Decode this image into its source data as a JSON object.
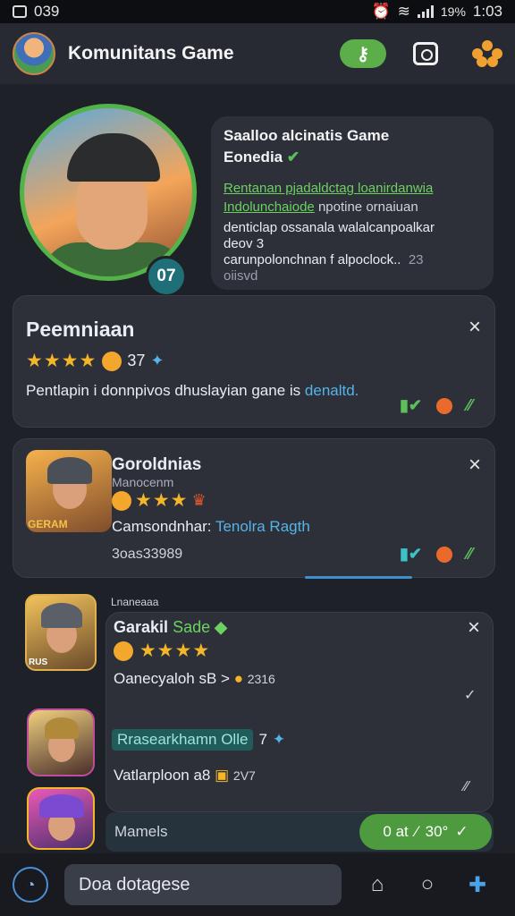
{
  "status_bar": {
    "time_left": "039",
    "battery": "19%",
    "time_right": "1:03"
  },
  "header": {
    "title": "Komunitans Game",
    "pill_icon": "key-icon"
  },
  "profile": {
    "level": "07",
    "info_title_1": "Saalloo alcinatis Game",
    "info_title_2": "Eonedia",
    "info_green_1": "Rentanan pjadaldctag loanirdanwia",
    "info_green_2": "Indolunchaiode",
    "info_green_2_rest": "npotine ornaiuan",
    "info_line_1": "denticlap ossanala walalcanpoalkar",
    "info_line_2": "deov 3",
    "info_line_3": "carunpolonchnan f alpoclock..",
    "info_line_3_num": "23",
    "info_line_4": "oiisvd"
  },
  "card1": {
    "title": "Peemniaan",
    "rating_count": "37",
    "desc": "Pentlapin i donnpivos dhuslayian gane is",
    "desc_link": "denaltd."
  },
  "card2": {
    "title": "Goroldnias",
    "subtitle": "Manocenm",
    "desc": "Camsondnhar:",
    "desc_link": "Tenolra Ragth",
    "meta": "3oas33989",
    "thumb_label": "GERAM"
  },
  "card3": {
    "section_label": "Lnaneaaa",
    "title": "Garakil",
    "title_green": "Sade",
    "line1": "Oanecyaloh sB >",
    "line1_num": "2316",
    "chip": "Rrasearkhamn Olle",
    "chip_num": "7",
    "line3": "Vatlarploon a8",
    "line3_num": "2V7",
    "thumb_label": "RUS"
  },
  "bottom_row": {
    "label": "Mamels",
    "pill": "0 at",
    "pill_num": "30°"
  },
  "dock": {
    "input_text": "Doa dotagese"
  },
  "colors": {
    "accent_green": "#5cae4a",
    "background": "#1e2128",
    "card": "#2d3039",
    "link_blue": "#55b3e8"
  }
}
